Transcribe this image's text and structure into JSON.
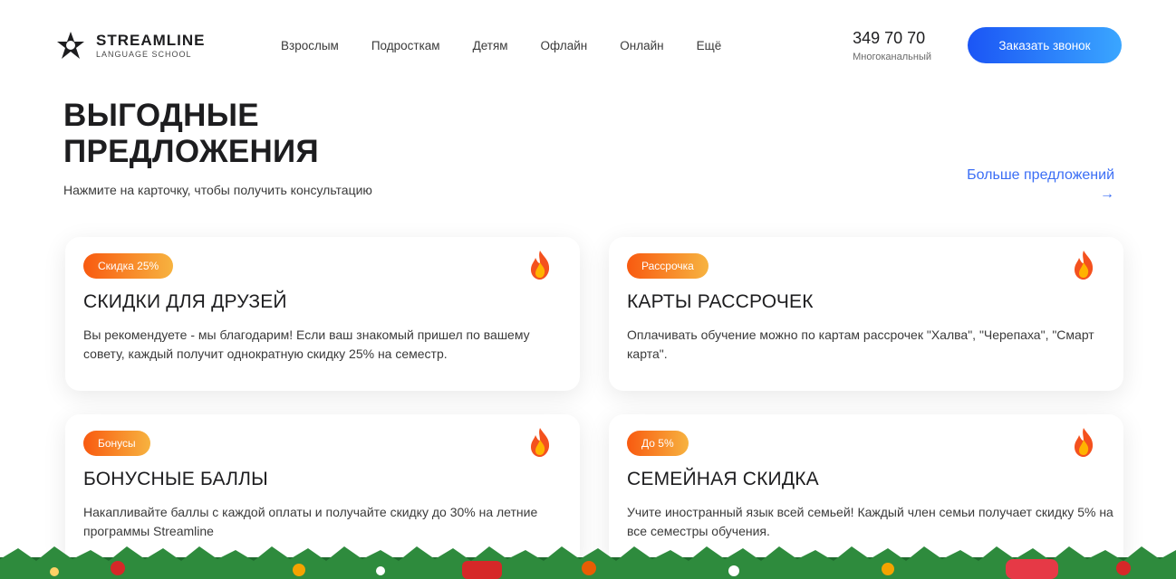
{
  "brand": {
    "name": "STREAMLINE",
    "tagline": "LANGUAGE SCHOOL"
  },
  "nav": {
    "items": [
      "Взрослым",
      "Подросткам",
      "Детям",
      "Офлайн",
      "Онлайн",
      "Ещё"
    ]
  },
  "contact": {
    "phone": "349 70 70",
    "caption": "Многоканальный"
  },
  "header": {
    "cta_label": "Заказать звонок"
  },
  "section": {
    "title": "ВЫГОДНЫЕ ПРЕДЛОЖЕНИЯ",
    "subtitle": "Нажмите на карточку, чтобы получить консультацию",
    "more_link": "Больше предложений",
    "more_arrow": "→"
  },
  "offers": [
    {
      "badge": "Скидка 25%",
      "title": "СКИДКИ ДЛЯ ДРУЗЕЙ",
      "text": "Вы рекомендуете - мы благодарим! Если ваш знакомый пришел по вашему совету, каждый получит однократную скидку 25% на семестр."
    },
    {
      "badge": "Рассрочка",
      "title": "КАРТЫ РАССРОЧЕК",
      "text": "Оплачивать обучение можно по картам рассрочек \"Халва\", \"Черепаха\", \"Смарт карта\"."
    },
    {
      "badge": "Бонусы",
      "title": "БОНУСНЫЕ БАЛЛЫ",
      "text": "Накапливайте баллы с каждой оплаты и получайте скидку до 30% на летние программы Streamline"
    },
    {
      "badge": "До 5%",
      "title": "СЕМЕЙНАЯ СКИДКА",
      "text": "Учите иностранный язык всей семьей! Каждый член семьи получает скидку 5% на все семестры обучения."
    }
  ],
  "icons": {
    "logo": "streamline-logo-icon",
    "fire": "fire-icon",
    "arrow": "arrow-right-icon"
  },
  "colors": {
    "accent_blue": "#3b6ef5",
    "cta_gradient_start": "#1b55f5",
    "cta_gradient_end": "#3aa6ff",
    "badge_gradient_start": "#f85a10",
    "badge_gradient_end": "#f7b340",
    "text_dark": "#1d1d1f"
  }
}
